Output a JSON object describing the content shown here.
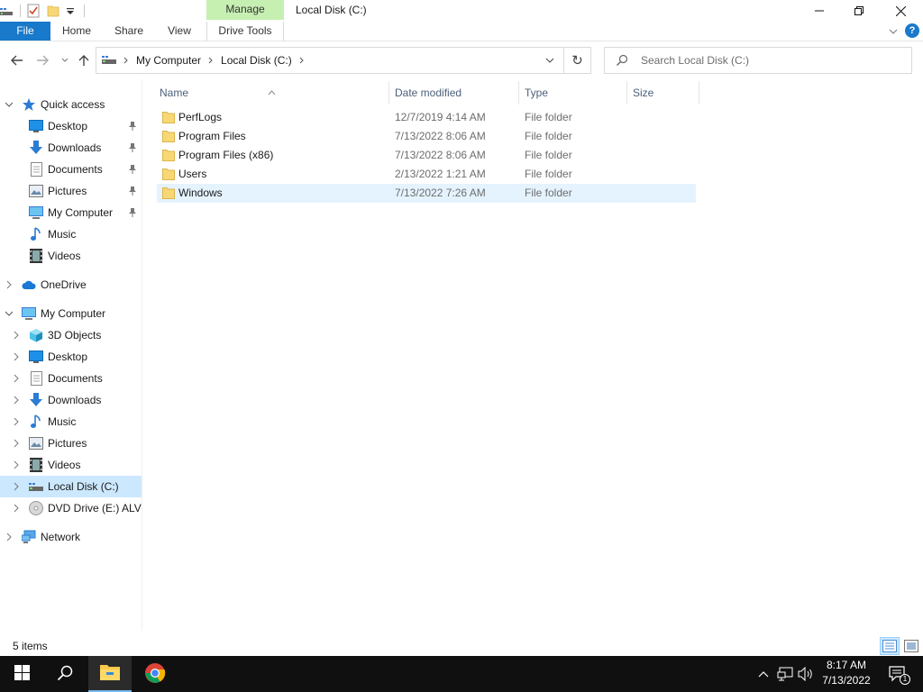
{
  "window": {
    "title": "Local Disk (C:)",
    "context_tab": "Manage"
  },
  "ribbon": {
    "tabs": [
      "File",
      "Home",
      "Share",
      "View",
      "Drive Tools"
    ]
  },
  "address": {
    "crumbs": [
      "My Computer",
      "Local Disk (C:)"
    ]
  },
  "search": {
    "placeholder": "Search Local Disk (C:)"
  },
  "nav": {
    "quick_access": "Quick access",
    "quick_items": [
      "Desktop",
      "Downloads",
      "Documents",
      "Pictures",
      "My Computer",
      "Music",
      "Videos"
    ],
    "onedrive": "OneDrive",
    "computer": "My Computer",
    "computer_items": [
      "3D Objects",
      "Desktop",
      "Documents",
      "Downloads",
      "Music",
      "Pictures",
      "Videos",
      "Local Disk (C:)",
      "DVD Drive (E:) ALVIN"
    ],
    "network": "Network"
  },
  "columns": [
    "Name",
    "Date modified",
    "Type",
    "Size"
  ],
  "files": [
    {
      "name": "PerfLogs",
      "date": "12/7/2019 4:14 AM",
      "type": "File folder"
    },
    {
      "name": "Program Files",
      "date": "7/13/2022 8:06 AM",
      "type": "File folder"
    },
    {
      "name": "Program Files (x86)",
      "date": "7/13/2022 8:06 AM",
      "type": "File folder"
    },
    {
      "name": "Users",
      "date": "2/13/2022 1:21 AM",
      "type": "File folder"
    },
    {
      "name": "Windows",
      "date": "7/13/2022 7:26 AM",
      "type": "File folder"
    }
  ],
  "status": {
    "item_count": "5 items"
  },
  "taskbar": {
    "time": "8:17 AM",
    "date": "7/13/2022",
    "notification_count": "1"
  },
  "colors": {
    "file_tab": "#1979ca",
    "manage_tab": "#c6efb2",
    "selection": "#cce8ff",
    "folder": "#f8d775",
    "taskbar": "#101010"
  }
}
